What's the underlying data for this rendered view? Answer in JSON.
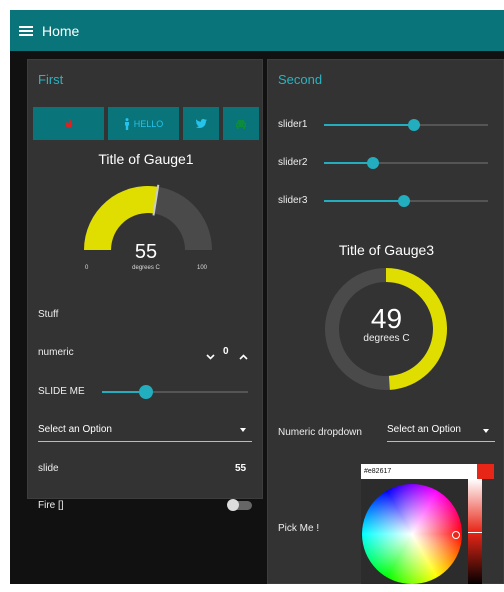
{
  "topbar": {
    "title": "Home",
    "menu_icon": "hamburger-menu-icon"
  },
  "colors": {
    "accent": "#22aebe",
    "header": "#097479",
    "gauge_fill": "#e0de00",
    "card": "#333333"
  },
  "first": {
    "title": "First",
    "buttons": [
      {
        "icon": "fire-icon",
        "label": "",
        "color": "#e0201f"
      },
      {
        "icon": "person-icon",
        "label": "HELLO",
        "color": "#25c3ec"
      },
      {
        "icon": "twitter-icon",
        "label": "",
        "color": "#25c3ec"
      },
      {
        "icon": "car-icon",
        "label": "",
        "color": "#0d8c3c"
      }
    ],
    "gauge1": {
      "title": "Title of Gauge1",
      "value": "55",
      "units": "degrees C",
      "min": "0",
      "max": "100",
      "fraction": 0.55
    },
    "stuff_label": "Stuff",
    "numeric": {
      "label": "numeric",
      "value": "0"
    },
    "slide_me": {
      "label": "SLIDE ME",
      "fraction": 0.3
    },
    "select": {
      "value": "Select an Option"
    },
    "slide": {
      "label": "slide",
      "value": "55"
    },
    "fire": {
      "label": "Fire []",
      "state": false
    }
  },
  "second": {
    "title": "Second",
    "slider1": {
      "label": "slider1",
      "fraction": 0.55
    },
    "slider2": {
      "label": "slider2",
      "fraction": 0.3
    },
    "slider3": {
      "label": "slider3",
      "fraction": 0.49
    },
    "gauge3": {
      "title": "Title of Gauge3",
      "value": "49",
      "units": "degrees C",
      "fraction": 0.49
    },
    "numeric_dropdown": {
      "label": "Numeric dropdown",
      "value": "Select an Option"
    },
    "pick_me": {
      "label": "Pick Me !",
      "hex": "#e82617"
    }
  }
}
